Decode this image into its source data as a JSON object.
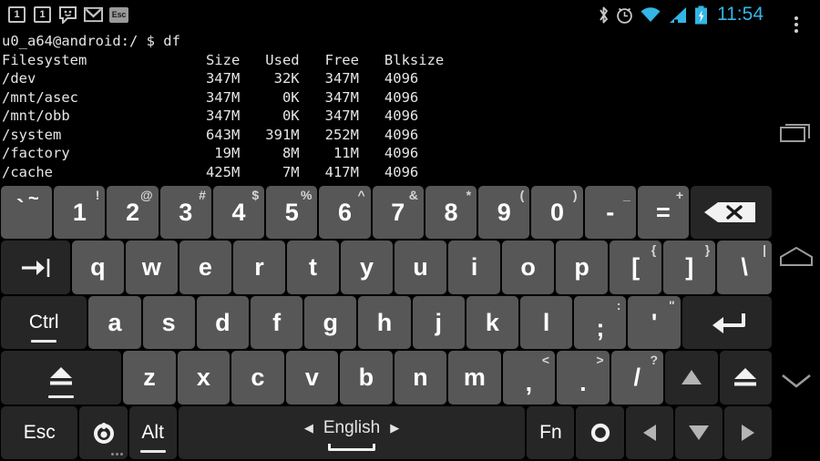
{
  "statusbar": {
    "notifications": [
      {
        "icon": "badge-one-icon",
        "label": "1"
      },
      {
        "icon": "badge-one-icon",
        "label": "1"
      },
      {
        "icon": "messaging-smiley-icon",
        "label": ""
      },
      {
        "icon": "gmail-envelope-icon",
        "label": ""
      },
      {
        "icon": "keyboard-esc-indicator-icon",
        "label": "Esc"
      }
    ],
    "system_icons": [
      "bluetooth-icon",
      "alarm-clock-icon",
      "wifi-icon",
      "cell-signal-icon",
      "battery-charging-icon"
    ],
    "clock": "11:54",
    "accent_color": "#33b5e5",
    "overflow": "overflow-menu-icon"
  },
  "terminal": {
    "prompt_line": "u0_a64@android:/ $ df",
    "header": "Filesystem              Size   Used   Free   Blksize",
    "rows": [
      "/dev                    347M    32K   347M   4096",
      "/mnt/asec               347M     0K   347M   4096",
      "/mnt/obb                347M     0K   347M   4096",
      "/system                 643M   391M   252M   4096",
      "/factory                 19M     8M    11M   4096",
      "/cache                  425M     7M   417M   4096"
    ],
    "table": {
      "columns": [
        "Filesystem",
        "Size",
        "Used",
        "Free",
        "Blksize"
      ],
      "data": [
        [
          "/dev",
          "347M",
          "32K",
          "347M",
          "4096"
        ],
        [
          "/mnt/asec",
          "347M",
          "0K",
          "347M",
          "4096"
        ],
        [
          "/mnt/obb",
          "347M",
          "0K",
          "347M",
          "4096"
        ],
        [
          "/system",
          "643M",
          "391M",
          "252M",
          "4096"
        ],
        [
          "/factory",
          "19M",
          "8M",
          "11M",
          "4096"
        ],
        [
          "/cache",
          "425M",
          "7M",
          "417M",
          "4096"
        ]
      ]
    },
    "text_color": "#e6e6e6",
    "background": "#000000"
  },
  "navbar": {
    "buttons": [
      {
        "name": "recents-icon",
        "label": ""
      },
      {
        "name": "home-icon",
        "label": ""
      },
      {
        "name": "hide-keyboard-chevron-icon",
        "label": ""
      }
    ]
  },
  "keyboard": {
    "key_color": "#575757",
    "modifier_key_color": "#262626",
    "label_color": "#ffffff",
    "rows": [
      {
        "name": "number-row",
        "keys": [
          {
            "name": "key-backtick",
            "main": "`",
            "sub": "~"
          },
          {
            "name": "key-1",
            "main": "1",
            "sub": "!"
          },
          {
            "name": "key-2",
            "main": "2",
            "sub": "@"
          },
          {
            "name": "key-3",
            "main": "3",
            "sub": "#"
          },
          {
            "name": "key-4",
            "main": "4",
            "sub": "$"
          },
          {
            "name": "key-5",
            "main": "5",
            "sub": "%"
          },
          {
            "name": "key-6",
            "main": "6",
            "sub": "^"
          },
          {
            "name": "key-7",
            "main": "7",
            "sub": "&"
          },
          {
            "name": "key-8",
            "main": "8",
            "sub": "*"
          },
          {
            "name": "key-9",
            "main": "9",
            "sub": "("
          },
          {
            "name": "key-0",
            "main": "0",
            "sub": ")"
          },
          {
            "name": "key-minus",
            "main": "-",
            "sub": "_"
          },
          {
            "name": "key-equals",
            "main": "=",
            "sub": "+"
          },
          {
            "name": "key-backspace",
            "main": "",
            "sub": ""
          }
        ]
      },
      {
        "name": "qwerty-row",
        "keys": [
          {
            "name": "key-tab",
            "main": "",
            "sub": ""
          },
          {
            "name": "key-q",
            "main": "q",
            "sub": ""
          },
          {
            "name": "key-w",
            "main": "w",
            "sub": ""
          },
          {
            "name": "key-e",
            "main": "e",
            "sub": ""
          },
          {
            "name": "key-r",
            "main": "r",
            "sub": ""
          },
          {
            "name": "key-t",
            "main": "t",
            "sub": ""
          },
          {
            "name": "key-y",
            "main": "y",
            "sub": ""
          },
          {
            "name": "key-u",
            "main": "u",
            "sub": ""
          },
          {
            "name": "key-i",
            "main": "i",
            "sub": ""
          },
          {
            "name": "key-o",
            "main": "o",
            "sub": ""
          },
          {
            "name": "key-p",
            "main": "p",
            "sub": ""
          },
          {
            "name": "key-bracket-left",
            "main": "[",
            "sub": "{"
          },
          {
            "name": "key-bracket-right",
            "main": "]",
            "sub": "}"
          },
          {
            "name": "key-backslash",
            "main": "\\",
            "sub": "|"
          }
        ]
      },
      {
        "name": "home-row",
        "keys": [
          {
            "name": "key-ctrl",
            "main": "Ctrl",
            "sub": ""
          },
          {
            "name": "key-a",
            "main": "a",
            "sub": ""
          },
          {
            "name": "key-s",
            "main": "s",
            "sub": ""
          },
          {
            "name": "key-d",
            "main": "d",
            "sub": ""
          },
          {
            "name": "key-f",
            "main": "f",
            "sub": ""
          },
          {
            "name": "key-g",
            "main": "g",
            "sub": ""
          },
          {
            "name": "key-h",
            "main": "h",
            "sub": ""
          },
          {
            "name": "key-j",
            "main": "j",
            "sub": ""
          },
          {
            "name": "key-k",
            "main": "k",
            "sub": ""
          },
          {
            "name": "key-l",
            "main": "l",
            "sub": ""
          },
          {
            "name": "key-semicolon",
            "main": ";",
            "sub": ":"
          },
          {
            "name": "key-quote",
            "main": "'",
            "sub": "\""
          },
          {
            "name": "key-enter",
            "main": "",
            "sub": ""
          }
        ]
      },
      {
        "name": "shift-row",
        "keys": [
          {
            "name": "key-shift-left",
            "main": "",
            "sub": ""
          },
          {
            "name": "key-z",
            "main": "z",
            "sub": ""
          },
          {
            "name": "key-x",
            "main": "x",
            "sub": ""
          },
          {
            "name": "key-c",
            "main": "c",
            "sub": ""
          },
          {
            "name": "key-v",
            "main": "v",
            "sub": ""
          },
          {
            "name": "key-b",
            "main": "b",
            "sub": ""
          },
          {
            "name": "key-n",
            "main": "n",
            "sub": ""
          },
          {
            "name": "key-m",
            "main": "m",
            "sub": ""
          },
          {
            "name": "key-comma",
            "main": ",",
            "sub": "<"
          },
          {
            "name": "key-period",
            "main": ".",
            "sub": ">"
          },
          {
            "name": "key-slash",
            "main": "/",
            "sub": "?"
          },
          {
            "name": "key-arrow-up",
            "main": "",
            "sub": ""
          },
          {
            "name": "key-shift-right",
            "main": "",
            "sub": ""
          }
        ]
      },
      {
        "name": "bottom-row",
        "keys": [
          {
            "name": "key-esc",
            "main": "Esc",
            "sub": ""
          },
          {
            "name": "key-settings",
            "main": "",
            "sub": ""
          },
          {
            "name": "key-alt",
            "main": "Alt",
            "sub": ""
          },
          {
            "name": "key-space",
            "main": "English",
            "sub": ""
          },
          {
            "name": "key-fn",
            "main": "Fn",
            "sub": ""
          },
          {
            "name": "key-circle",
            "main": "",
            "sub": ""
          },
          {
            "name": "key-arrow-left",
            "main": "",
            "sub": ""
          },
          {
            "name": "key-arrow-down",
            "main": "",
            "sub": ""
          },
          {
            "name": "key-arrow-right",
            "main": "",
            "sub": ""
          }
        ]
      }
    ],
    "space_language": "English",
    "space_prev_arrow": "◀",
    "space_next_arrow": "▶"
  }
}
